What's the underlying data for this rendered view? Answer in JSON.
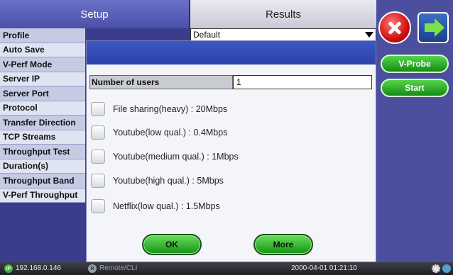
{
  "tabs": {
    "setup": "Setup",
    "results": "Results"
  },
  "left_list": [
    "Profile",
    "Auto Save",
    "V-Perf Mode",
    "Server IP",
    "Server Port",
    "Protocol",
    "Transfer Direction",
    "TCP Streams",
    "Throughput Test",
    "Duration(s)",
    "Throughput Band",
    "V-Perf Throughput"
  ],
  "profile_value": "Default",
  "side_buttons": {
    "close_icon": "close-icon",
    "next_icon": "arrow-right-icon",
    "vprobe": "V-Probe",
    "start": "Start"
  },
  "dialog": {
    "title": "",
    "users_label": "Number of users",
    "users_value": "1",
    "options": [
      "File sharing(heavy) : 20Mbps",
      "Youtube(low qual.) : 0.4Mbps",
      "Youtube(medium qual.) : 1Mbps",
      "Youtube(high qual.) : 5Mbps",
      "Netflix(low qual.) : 1.5Mbps"
    ],
    "ok_label": "OK",
    "more_label": "More"
  },
  "status_bar": {
    "ip_icon": "IP",
    "ip": "192.168.0.146",
    "remote_icon": "R",
    "remote": "Remote/CLI",
    "datetime": "2000-04-01 01:21:10"
  },
  "colors": {
    "accent": "#3b58c4",
    "button_green": "#139414",
    "close_red": "#d01010"
  }
}
